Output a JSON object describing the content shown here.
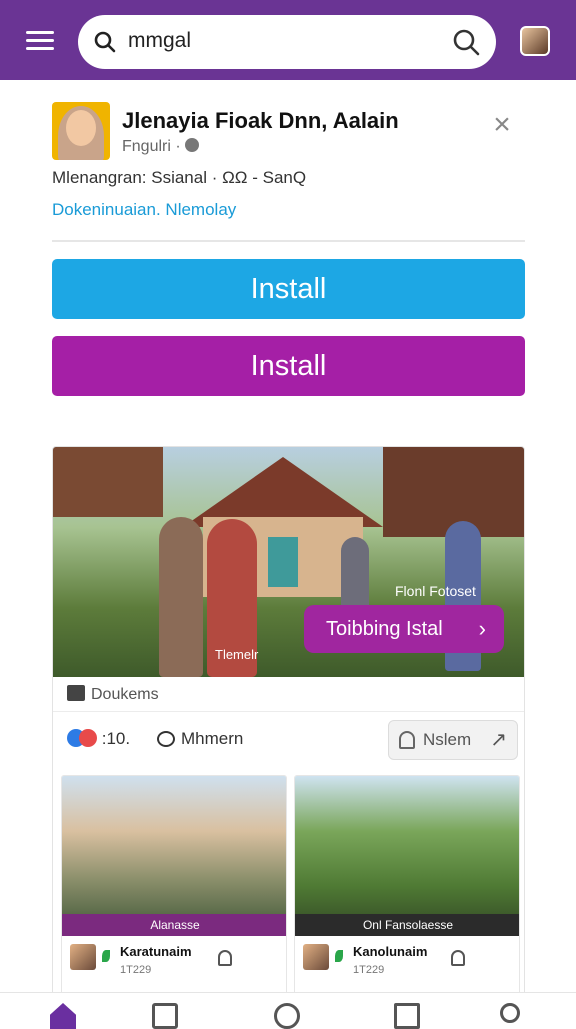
{
  "header": {
    "search_query": "mmgal",
    "search_icon": "search-icon",
    "menu_icon": "hamburger-icon"
  },
  "profile": {
    "name": "Jlenayia Fioak Dnn, Aalain",
    "sub": "Fngulri ·",
    "meta": "Mlenangran: Ssianal · ΩΩ - SanQ",
    "link": "Dokeninuaian. Nlemolay"
  },
  "buttons": {
    "primary": "Install",
    "secondary": "Install"
  },
  "post": {
    "hero_label": "Tlemelr",
    "hero_overlay_text": "Flonl Fotoset",
    "cta_label": "Toibbing Istal",
    "source_label": "Doukems",
    "reaction_count": ":10.",
    "comment_label": "Mhmern",
    "share_label": "Nslem"
  },
  "tiles": [
    {
      "caption": "Alanasse",
      "title": "Karatunaim",
      "time": "1T229"
    },
    {
      "caption": "Onl Fansolaesse",
      "title": "Kanolunaim",
      "time": "1T229"
    }
  ],
  "colors": {
    "topbar": "#6a3494",
    "blue_button": "#1da7e4",
    "purple_button": "#a51fa6",
    "link": "#1a9bd7"
  }
}
